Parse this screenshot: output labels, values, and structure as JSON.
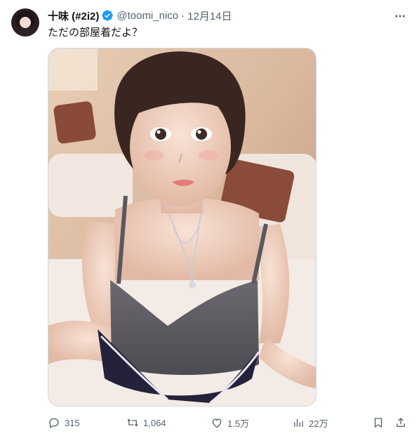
{
  "author": {
    "display_name": "十味 (#2i2)",
    "handle": "@toomi_nico",
    "separator": "·",
    "date": "12月14日"
  },
  "tweet": {
    "text": "ただの部屋着だよ？"
  },
  "icons": {
    "avatar": "profile-avatar",
    "verified": "verified-badge-icon",
    "more": "more-options-icon",
    "reply": "reply-icon",
    "retweet": "retweet-icon",
    "like": "like-icon",
    "views": "views-icon",
    "bookmark": "bookmark-icon",
    "share": "share-icon"
  },
  "stats": {
    "replies": "315",
    "retweets": "1,064",
    "likes": "1.5万",
    "views": "22万"
  },
  "colors": {
    "text_primary": "#0f1419",
    "text_secondary": "#536471",
    "verified_blue": "#1d9bf0",
    "border": "#cfd9de"
  }
}
